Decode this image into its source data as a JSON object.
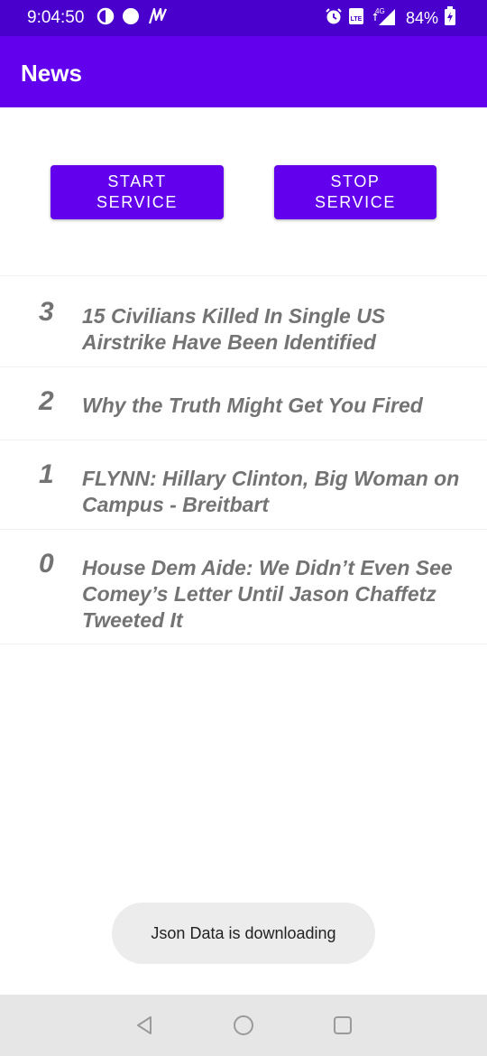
{
  "status_bar": {
    "time": "9:04:50",
    "battery": "84%",
    "icons": [
      "data-saver-icon",
      "dot-icon",
      "m-icon",
      "alarm-icon",
      "volte-icon",
      "4g-signal-icon",
      "battery-charging-icon"
    ],
    "volte_text": "LTE",
    "network_text": "4G"
  },
  "app_bar": {
    "title": "News"
  },
  "buttons": {
    "start": "START\nSERVICE",
    "stop": "STOP\nSERVICE"
  },
  "news": [
    {
      "number": "3",
      "title": "15 Civilians Killed In Single US Airstrike Have Been Identified"
    },
    {
      "number": "2",
      "title": "Why the Truth Might Get You Fired"
    },
    {
      "number": "1",
      "title": "FLYNN: Hillary Clinton, Big Woman on Campus - Breitbart"
    },
    {
      "number": "0",
      "title": "House Dem Aide: We Didn’t Even See Comey’s Letter Until Jason Chaffetz Tweeted It"
    }
  ],
  "toast": {
    "text": "Json Data is downloading"
  },
  "nav_bar": {
    "icons": [
      "back-icon",
      "home-icon",
      "recents-icon"
    ]
  },
  "colors": {
    "status_bar": "#4a00cc",
    "primary": "#6200ee",
    "news_text": "#737373",
    "toast_bg": "#ececec",
    "nav_bar": "#e6e6e6"
  }
}
